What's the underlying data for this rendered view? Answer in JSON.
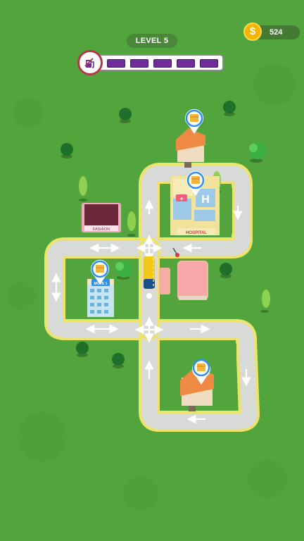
{
  "hud": {
    "level_label": "LEVEL 5",
    "coins": "524",
    "coin_symbol": "$",
    "fuel": {
      "icon": "fuel-pump-icon",
      "segments_total": 5,
      "segments_filled": 5,
      "color": "#6e2d99"
    }
  },
  "map": {
    "buildings": {
      "hospital_sign": "HOSPITAL",
      "helipad_letter": "H",
      "fashion_sign": "FASHION",
      "move_badge": "MOVE 1"
    },
    "delivery_markers": 4,
    "colors": {
      "grass": "#52a53c",
      "road": "#d7dad6",
      "road_edge": "#eee36a",
      "marker": "#2f8fe8"
    }
  }
}
